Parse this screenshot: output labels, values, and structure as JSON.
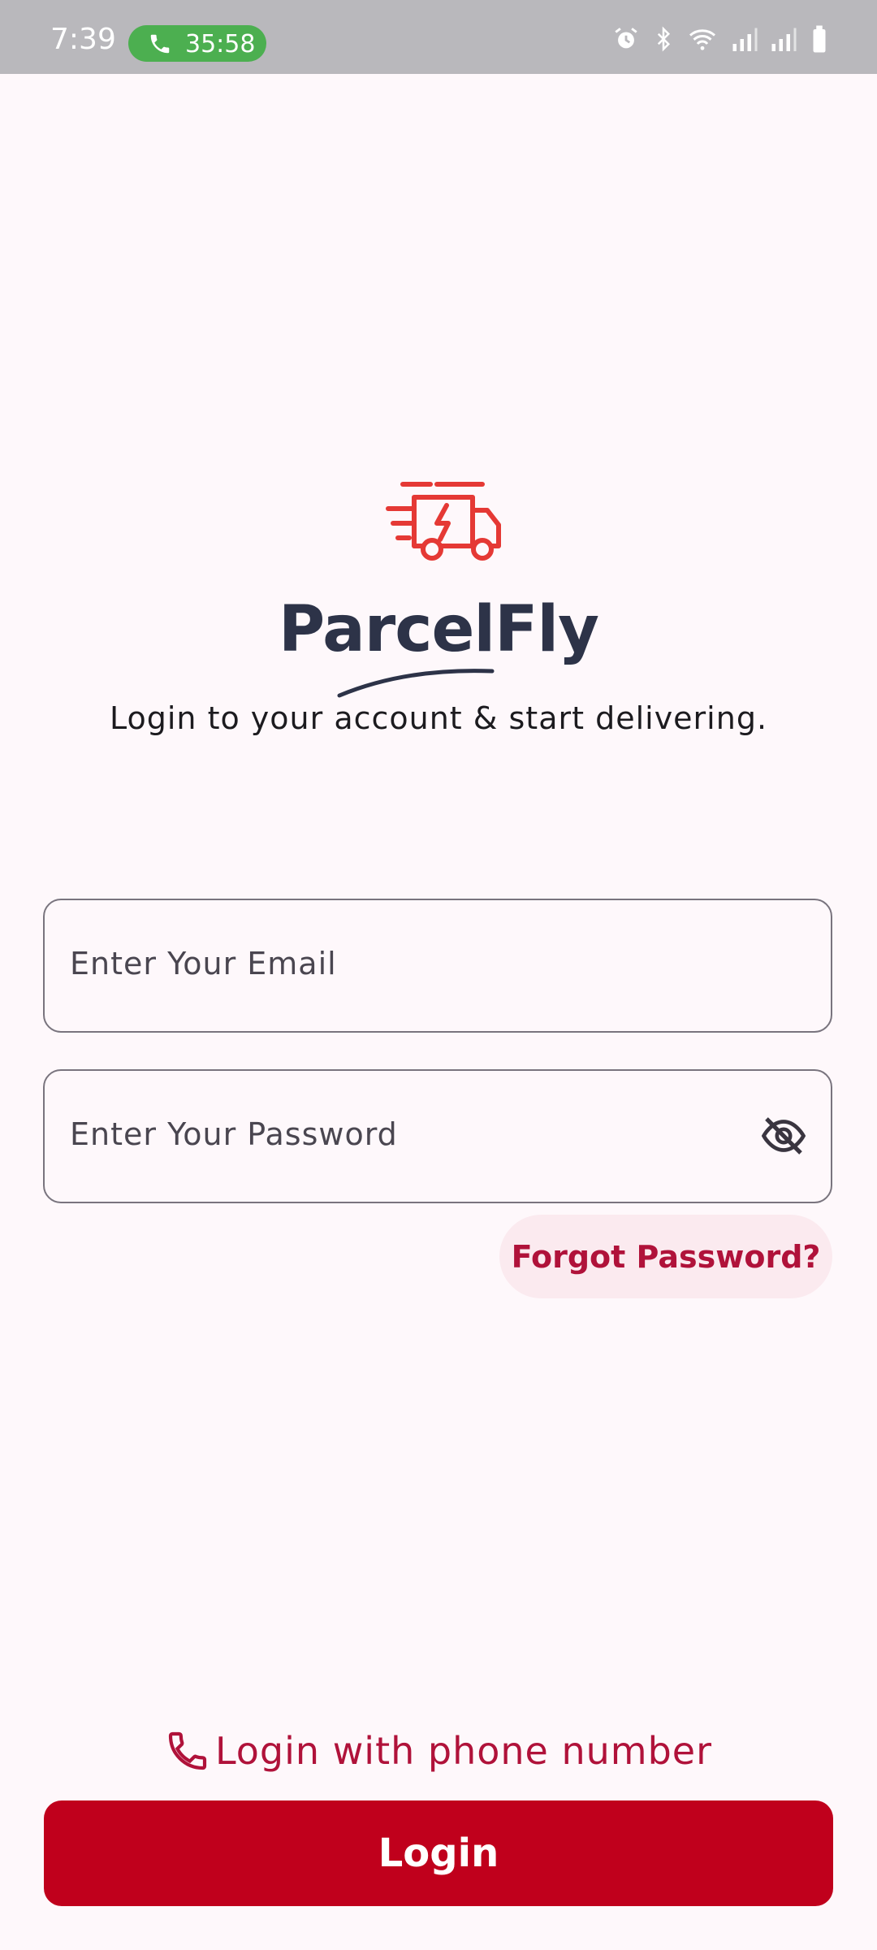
{
  "status_bar": {
    "time": "7:39",
    "call_duration": "35:58",
    "icons": [
      "alarm-icon",
      "bluetooth-icon",
      "wifi-icon",
      "signal-icon",
      "signal-icon",
      "battery-icon"
    ]
  },
  "brand": {
    "name": "ParcelFly",
    "subtitle": "Login to your account & start delivering.",
    "logo_icon": "delivery-truck-icon",
    "accent_color": "#E53935"
  },
  "form": {
    "email_placeholder": "Enter Your Email",
    "password_placeholder": "Enter Your Password",
    "visibility_icon": "eye-off-icon",
    "forgot_label": "Forgot Password?"
  },
  "actions": {
    "phone_login_label": "Login with phone number",
    "phone_icon": "phone-icon",
    "login_label": "Login",
    "primary_color": "#C0001C"
  }
}
